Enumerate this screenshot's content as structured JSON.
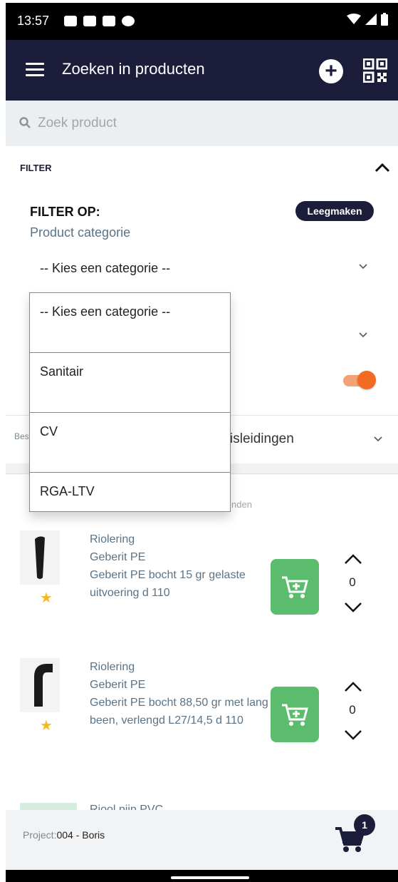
{
  "status_bar": {
    "time": "13:57"
  },
  "app_bar": {
    "title": "Zoeken in producten",
    "menu_icon": "hamburger-icon",
    "add_icon": "plus-circle-icon",
    "qr_icon": "qr-code-icon"
  },
  "search": {
    "placeholder": "Zoek product",
    "value": ""
  },
  "filter": {
    "header": "FILTER",
    "filter_by": "FILTER OP:",
    "clear_label": "Leegmaken",
    "category_label": "Product categorie",
    "category_selected": "-- Kies een categorie --",
    "toggle_on": true,
    "accent": "#f26b22"
  },
  "dropdown": {
    "options": [
      "-- Kies een categorie --",
      "Sanitair",
      "CV",
      "RGA-LTV"
    ]
  },
  "list_header": {
    "left_text": "Bes",
    "dropdown_text": "isleidingen",
    "found_text": "nden"
  },
  "products": [
    {
      "line1": "Riolering",
      "line2": "Geberit PE",
      "line3": "Geberit PE bocht 15 gr gelaste uitvoering d 110",
      "qty": "0"
    },
    {
      "line1": "Riolering",
      "line2": "Geberit PE",
      "line3": "Geberit PE bocht 88,50 gr met lang been, verlengd L27/14,5 d 110",
      "qty": "0"
    }
  ],
  "partial_product": {
    "text": "Riool pijp PVC"
  },
  "bottom_bar": {
    "project_label": "Project:",
    "project_value": "004 - Boris",
    "cart_count": "1"
  },
  "colors": {
    "navy": "#1c1d3a",
    "green": "#5cbc6d",
    "star": "#f5b921"
  }
}
